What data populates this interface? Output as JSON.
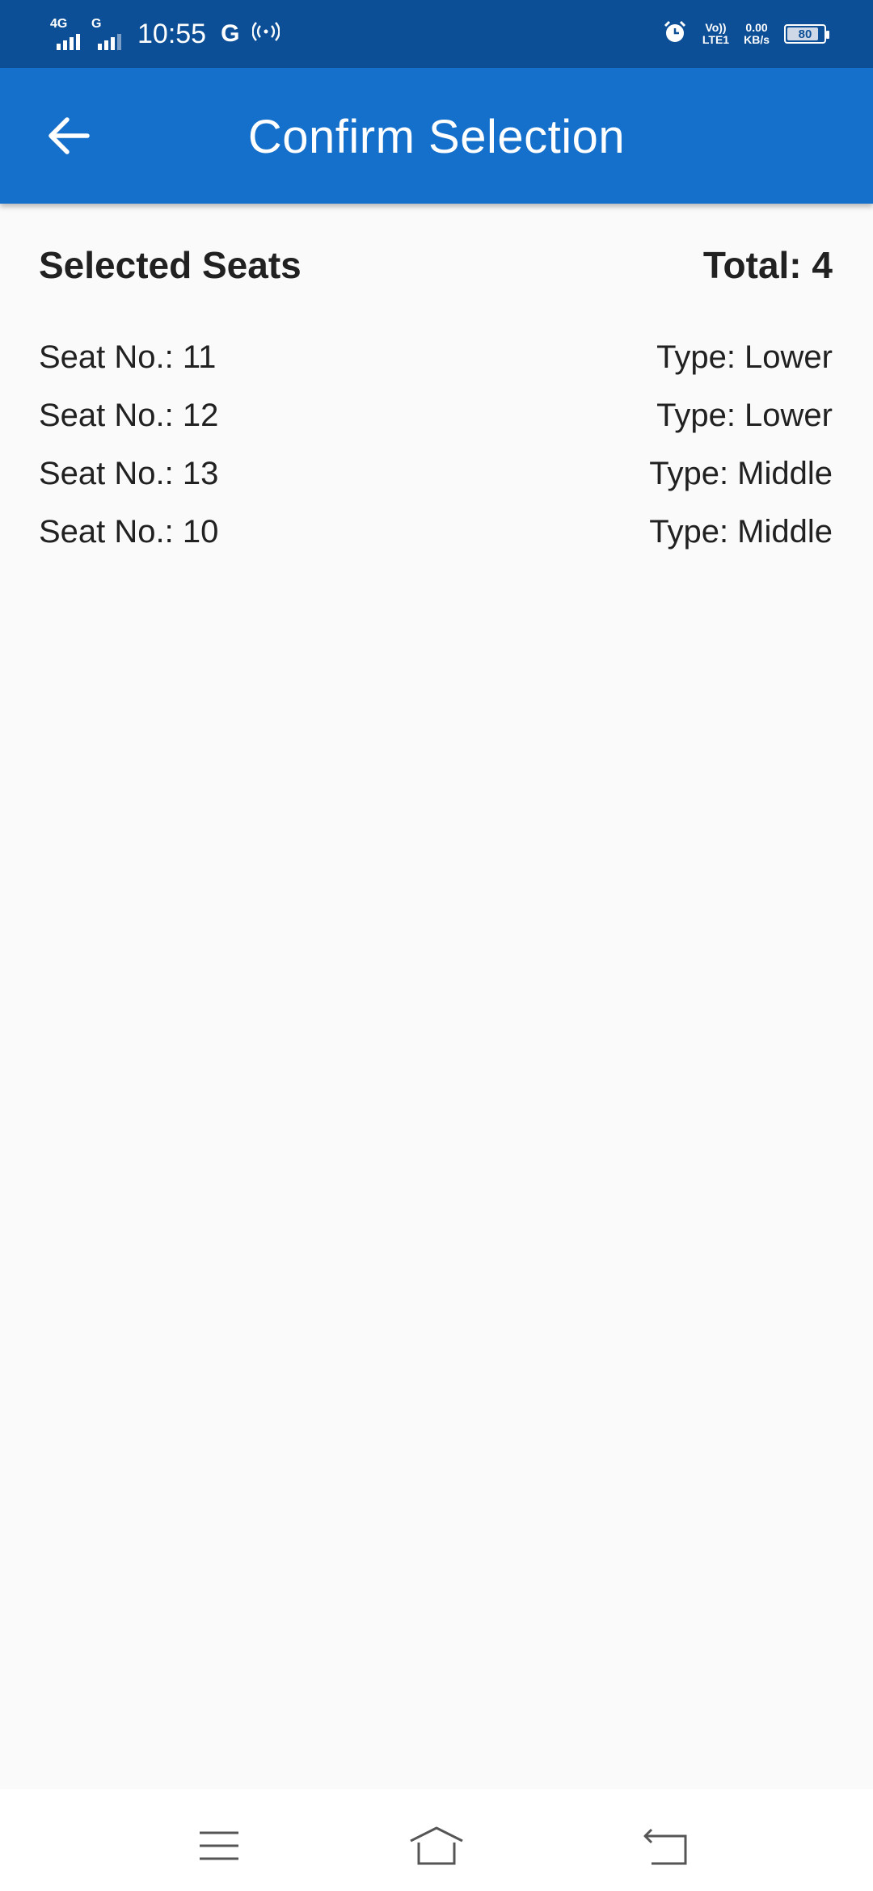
{
  "status_bar": {
    "network1": "4G",
    "network2": "G",
    "time": "10:55",
    "carrier_icon": "G",
    "volte_top": "Vo))",
    "volte_bottom": "LTE1",
    "speed_value": "0.00",
    "speed_unit": "KB/s",
    "battery_level": "80",
    "icons": [
      "signal-icon",
      "hotspot-icon",
      "alarm-icon",
      "battery-icon"
    ]
  },
  "app_bar": {
    "title": "Confirm Selection",
    "back_icon": "arrow-back-icon",
    "color": "#1570cc"
  },
  "main": {
    "section_title": "Selected Seats",
    "total_label": "Total: 4",
    "seats": [
      {
        "seat": "Seat No.: 11",
        "type": "Type: Lower"
      },
      {
        "seat": "Seat No.: 12",
        "type": "Type: Lower"
      },
      {
        "seat": "Seat No.: 13",
        "type": "Type: Middle"
      },
      {
        "seat": "Seat No.: 10",
        "type": "Type: Middle"
      }
    ]
  },
  "nav_bar": {
    "icons": [
      "menu-icon",
      "home-icon",
      "back-icon"
    ]
  }
}
